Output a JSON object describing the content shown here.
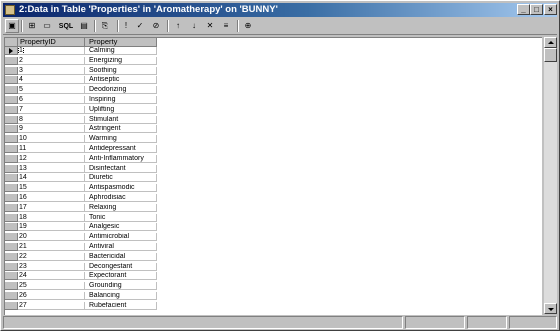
{
  "window": {
    "title": "2:Data in Table 'Properties' in 'Aromatherapy' on 'BUNNY'"
  },
  "toolbar": {
    "buttons": [
      {
        "name": "properties-icon",
        "glyph": "▣"
      },
      {
        "name": "results-grid-icon",
        "glyph": "⊞"
      },
      {
        "name": "results-pane-icon",
        "glyph": "▭"
      },
      {
        "name": "sql-pane-label",
        "label": "SQL"
      },
      {
        "name": "diagram-pane-icon",
        "glyph": "▤"
      },
      {
        "name": "change-type-icon",
        "glyph": "⎘"
      },
      {
        "name": "run-icon",
        "glyph": "!"
      },
      {
        "name": "verify-sql-icon",
        "glyph": "✓"
      },
      {
        "name": "remove-filter-icon",
        "glyph": "⊘"
      },
      {
        "name": "sort-ascending-icon",
        "glyph": "↑"
      },
      {
        "name": "sort-descending-icon",
        "glyph": "↓"
      },
      {
        "name": "filter-icon",
        "glyph": "✕"
      },
      {
        "name": "group-by-icon",
        "glyph": "≡"
      },
      {
        "name": "add-table-icon",
        "glyph": "⊕"
      }
    ]
  },
  "grid": {
    "columns": [
      "PropertyID",
      "Property"
    ],
    "rows": [
      {
        "id": "1",
        "property": "Calming"
      },
      {
        "id": "2",
        "property": "Energizing"
      },
      {
        "id": "3",
        "property": "Soothing"
      },
      {
        "id": "4",
        "property": "Antiseptic"
      },
      {
        "id": "5",
        "property": "Deodorizing"
      },
      {
        "id": "6",
        "property": "Inspiring"
      },
      {
        "id": "7",
        "property": "Uplifting"
      },
      {
        "id": "8",
        "property": "Stimulant"
      },
      {
        "id": "9",
        "property": "Astringent"
      },
      {
        "id": "10",
        "property": "Warming"
      },
      {
        "id": "11",
        "property": "Antidepressant"
      },
      {
        "id": "12",
        "property": "Anti-Inflammatory"
      },
      {
        "id": "13",
        "property": "Disinfectant"
      },
      {
        "id": "14",
        "property": "Diuretic"
      },
      {
        "id": "15",
        "property": "Antispasmodic"
      },
      {
        "id": "16",
        "property": "Aphrodisiac"
      },
      {
        "id": "17",
        "property": "Relaxing"
      },
      {
        "id": "18",
        "property": "Tonic"
      },
      {
        "id": "19",
        "property": "Analgesic"
      },
      {
        "id": "20",
        "property": "Antimicrobial"
      },
      {
        "id": "21",
        "property": "Antiviral"
      },
      {
        "id": "22",
        "property": "Bactericidal"
      },
      {
        "id": "23",
        "property": "Decongestant"
      },
      {
        "id": "24",
        "property": "Expectorant"
      },
      {
        "id": "25",
        "property": "Grounding"
      },
      {
        "id": "26",
        "property": "Balancing"
      },
      {
        "id": "27",
        "property": "Rubefacient"
      }
    ]
  },
  "colors": {
    "titlebar_start": "#0a246a",
    "titlebar_end": "#a6caf0",
    "chrome": "#c0c0c0"
  }
}
